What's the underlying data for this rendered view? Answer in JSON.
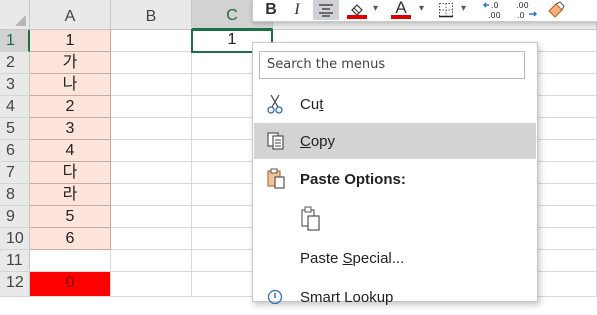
{
  "sheet": {
    "columns": [
      "A",
      "B",
      "C"
    ],
    "rows": [
      "1",
      "2",
      "3",
      "4",
      "5",
      "6",
      "7",
      "8",
      "9",
      "10",
      "11",
      "12"
    ],
    "colA": [
      "1",
      "가",
      "나",
      "2",
      "3",
      "4",
      "다",
      "라",
      "5",
      "6",
      "",
      "0"
    ],
    "c1": "1",
    "colors": {
      "pink": "#fde4da",
      "red": "#ff0000",
      "selection": "#1e7145"
    }
  },
  "mini_toolbar": {
    "bold": "B",
    "italic": "I",
    "font_color_letter": "A",
    "font_color": "#e00000"
  },
  "context_menu": {
    "search_placeholder": "Search the menus",
    "cut": {
      "pre": "Cu",
      "key": "t"
    },
    "copy": {
      "key": "C",
      "post": "opy"
    },
    "paste_options": "Paste Options:",
    "paste_special": {
      "pre": "Paste ",
      "key": "S",
      "post": "pecial..."
    },
    "smart_lookup": "Smart Lookup"
  }
}
